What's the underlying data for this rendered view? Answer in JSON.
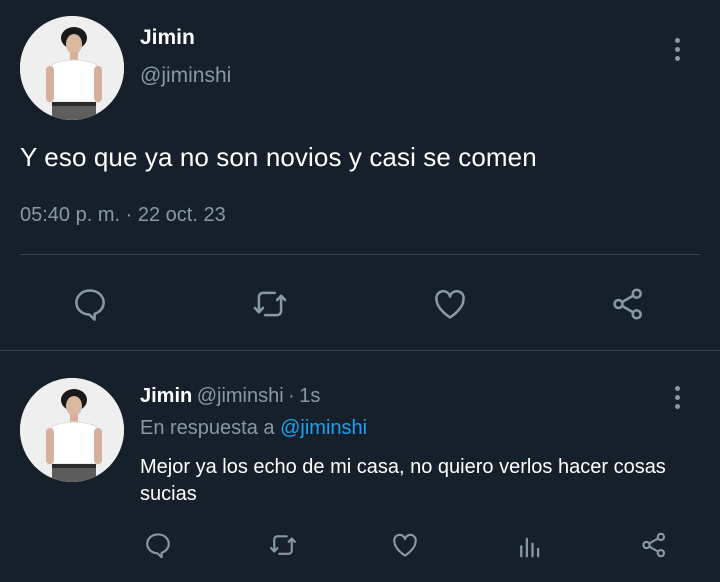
{
  "main_tweet": {
    "name": "Jimin",
    "handle": "@jiminshi",
    "text": "Y eso que ya no son novios y casi se comen",
    "time": "05:40 p. m.",
    "separator": "·",
    "date": "22 oct. 23"
  },
  "reply_tweet": {
    "name": "Jimin",
    "handle": "@jiminshi",
    "separator": "·",
    "age": "1s",
    "replying_prefix": "En respuesta a",
    "replying_handle": "@jiminshi",
    "text": "Mejor ya los echo de mi casa, no quiero verlos hacer cosas sucias"
  },
  "colors": {
    "background": "#15202b",
    "muted": "#8899a6",
    "divider": "#38444d",
    "link": "#1da1f2"
  },
  "icons": {
    "main_actions": [
      "reply-icon",
      "retweet-icon",
      "like-icon",
      "share-icon"
    ],
    "reply_actions": [
      "reply-icon",
      "retweet-icon",
      "like-icon",
      "analytics-icon",
      "share-icon"
    ],
    "menu": "more-options-icon"
  }
}
